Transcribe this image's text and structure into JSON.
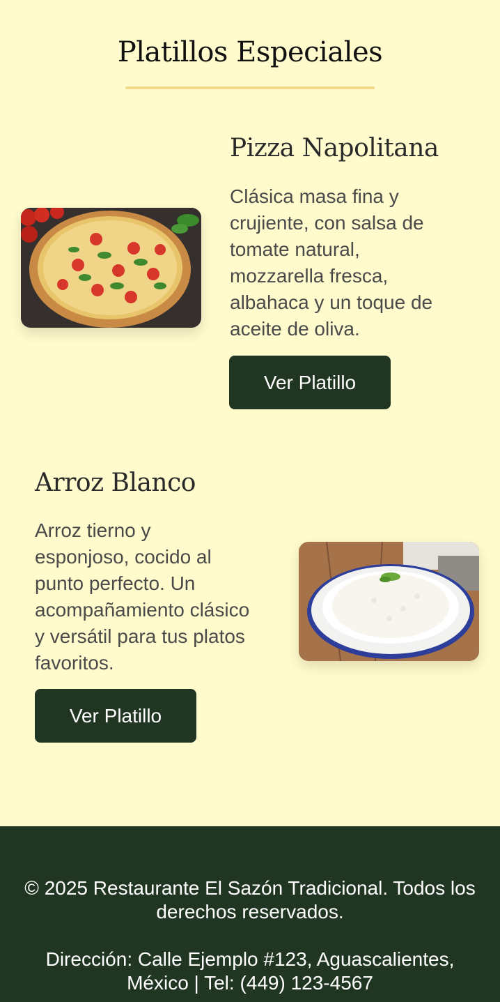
{
  "section": {
    "title": "Platillos Especiales"
  },
  "dishes": [
    {
      "name": "Pizza Napolitana",
      "description_lines": [
        "Clásica masa fina y",
        "crujiente, con salsa de",
        "tomate natural,",
        "mozzarella fresca,",
        "albahaca y un toque de",
        "aceite de oliva."
      ],
      "button_label": "Ver Platillo"
    },
    {
      "name": "Arroz Blanco",
      "description_lines": [
        "Arroz tierno y",
        "esponjoso, cocido al",
        "punto perfecto. Un",
        "acompañamiento clásico",
        "y versátil para tus platos",
        "favoritos."
      ],
      "button_label": "Ver Platillo"
    }
  ],
  "footer": {
    "copyright_lines": [
      "© 2025 Restaurante El Sazón Tradicional. Todos los",
      "derechos reservados."
    ],
    "contact_lines": [
      "Dirección: Calle Ejemplo #123, Aguascalientes,",
      "México | Tel: (449) 123-4567"
    ]
  },
  "colors": {
    "background": "#fffbcc",
    "accent_rule": "#f3d98a",
    "button": "#213622",
    "footer": "#213622"
  }
}
